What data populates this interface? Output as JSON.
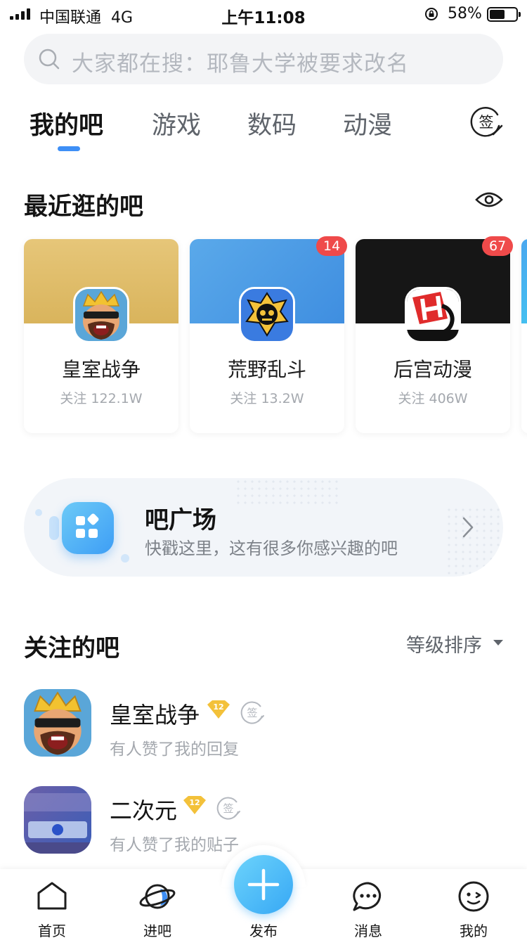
{
  "status_bar": {
    "carrier": "中国联通",
    "network": "4G",
    "time": "上午11:08",
    "battery": "58%",
    "battery_level": 0.58
  },
  "search": {
    "placeholder": "大家都在搜：耶鲁大学被要求改名"
  },
  "tabs": [
    {
      "label": "我的吧",
      "active": true
    },
    {
      "label": "游戏",
      "active": false
    },
    {
      "label": "数码",
      "active": false
    },
    {
      "label": "动漫",
      "active": false
    }
  ],
  "sign_label": "签",
  "recent": {
    "title": "最近逛的吧",
    "cards": [
      {
        "name": "皇室战争",
        "followers": "关注 122.1W",
        "badge": null,
        "header_color": "#e2c170"
      },
      {
        "name": "荒野乱斗",
        "followers": "关注 13.2W",
        "badge": "14",
        "header_color": "#4d9ee8"
      },
      {
        "name": "后宫动漫",
        "followers": "关注 406W",
        "badge": "67",
        "header_color": "#161616"
      }
    ]
  },
  "plaza": {
    "title": "吧广场",
    "subtitle": "快戳这里，这有很多你感兴趣的吧"
  },
  "followed": {
    "title": "关注的吧",
    "sort_label": "等级排序",
    "items": [
      {
        "name": "皇室战争",
        "level": "12",
        "sign": "签",
        "note": "有人赞了我的回复"
      },
      {
        "name": "二次元",
        "level": "12",
        "sign": "签",
        "note": "有人赞了我的贴子"
      }
    ]
  },
  "bottom_nav": {
    "home": "首页",
    "explore": "进吧",
    "post": "发布",
    "messages": "消息",
    "me": "我的"
  },
  "colors": {
    "accent": "#3e8ff6",
    "badge": "#ef4a4a",
    "level_gold": "#f3c13a"
  }
}
